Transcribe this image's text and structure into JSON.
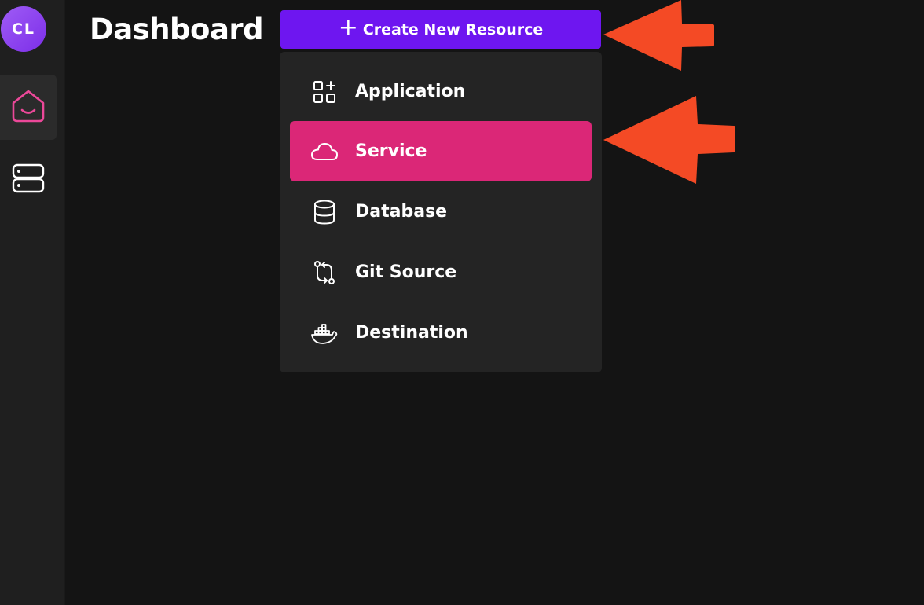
{
  "user": {
    "initials": "CL"
  },
  "sidebar": {
    "items": [
      {
        "icon": "home-icon",
        "active": true
      },
      {
        "icon": "servers-icon",
        "active": false
      }
    ]
  },
  "header": {
    "title": "Dashboard"
  },
  "create_button": {
    "icon": "plus-icon",
    "label": "Create New Resource"
  },
  "dropdown": {
    "items": [
      {
        "icon": "apps-icon",
        "label": "Application",
        "active": false
      },
      {
        "icon": "cloud-icon",
        "label": "Service",
        "active": true
      },
      {
        "icon": "database-icon",
        "label": "Database",
        "active": false
      },
      {
        "icon": "git-compare-icon",
        "label": "Git Source",
        "active": false
      },
      {
        "icon": "docker-icon",
        "label": "Destination",
        "active": false
      }
    ]
  },
  "colors": {
    "background": "#141414",
    "sidebar": "#1f1f1f",
    "create_button": "#6e16f0",
    "active_item": "#db2777",
    "home_icon": "#ec4899",
    "annotation_arrow": "#f44a25"
  }
}
